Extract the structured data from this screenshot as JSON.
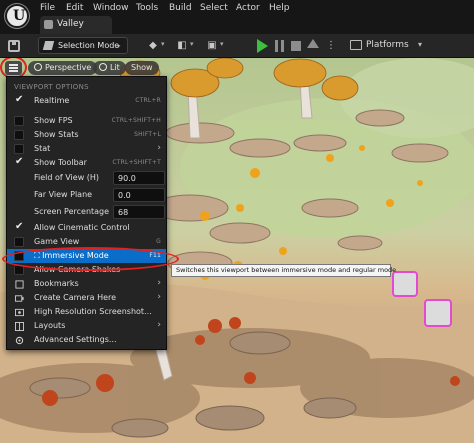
{
  "menubar": {
    "items": [
      "File",
      "Edit",
      "Window",
      "Tools",
      "Build",
      "Select",
      "Actor",
      "Help"
    ],
    "project_tab": "Valley"
  },
  "toolbar": {
    "mode_label": "Selection Mode",
    "platforms_label": "Platforms"
  },
  "viewport_bar": {
    "perspective_label": "Perspective",
    "lit_label": "Lit",
    "show_label": "Show"
  },
  "menu": {
    "section_header": "VIEWPORT OPTIONS",
    "items": [
      {
        "label": "Realtime",
        "shortcut": "CTRL+R",
        "checked": true
      },
      {
        "label": "Show FPS",
        "shortcut": "CTRL+SHIFT+H",
        "checked": false
      },
      {
        "label": "Show Stats",
        "shortcut": "SHIFT+L",
        "checked": false
      },
      {
        "label": "Stat",
        "submenu": true
      },
      {
        "label": "Show Toolbar",
        "shortcut": "CTRL+SHIFT+T",
        "checked": true
      },
      {
        "label": "Field of View (H)",
        "value": "90.0"
      },
      {
        "label": "Far View Plane",
        "value": "0.0"
      },
      {
        "label": "Screen Percentage",
        "value": "68"
      },
      {
        "label": "Allow Cinematic Control",
        "checked": true
      },
      {
        "label": "Game View",
        "shortcut": "G",
        "checked": false
      },
      {
        "label": "Immersive Mode",
        "shortcut": "F11",
        "active": true
      },
      {
        "label": "Allow Camera Shakes"
      },
      {
        "label": "Bookmarks",
        "submenu": true
      },
      {
        "label": "Create Camera Here",
        "submenu": true
      },
      {
        "label": "High Resolution Screenshot..."
      },
      {
        "label": "Layouts",
        "submenu": true
      },
      {
        "label": "Advanced Settings..."
      }
    ]
  },
  "tooltip": "Switches this viewport between immersive mode and regular mode",
  "colors": {
    "accent_blue": "#0a6ec8",
    "highlight_red": "#e42020",
    "play_green": "#3fbf3f"
  }
}
